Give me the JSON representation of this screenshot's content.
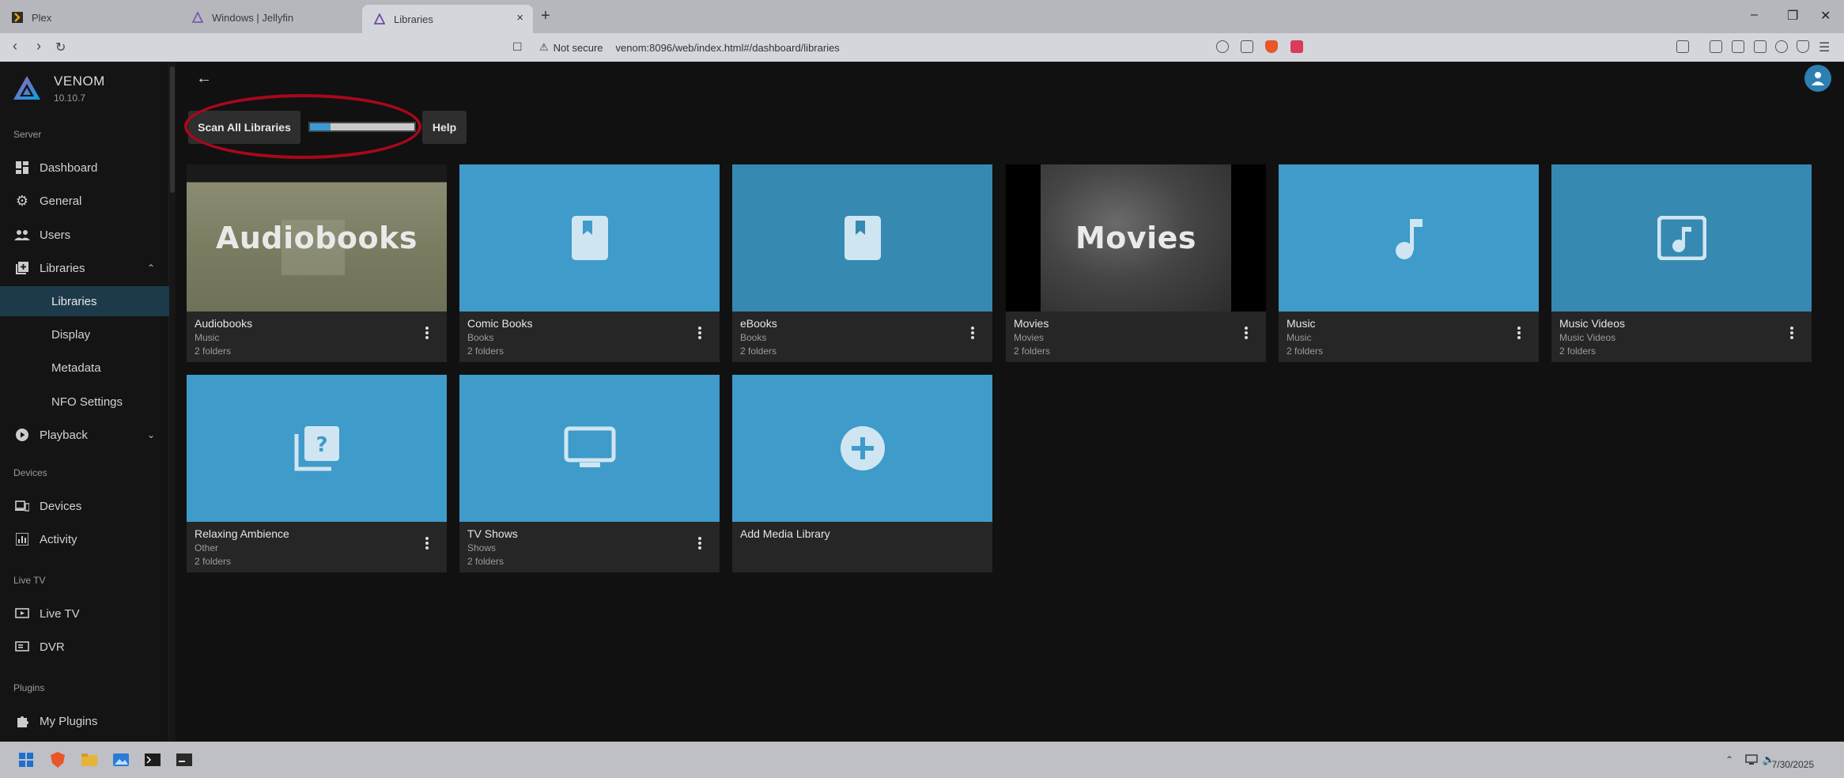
{
  "browser": {
    "tabs": [
      {
        "label": "Plex"
      },
      {
        "label": "Windows | Jellyfin"
      },
      {
        "label": "Libraries",
        "close": "×"
      }
    ],
    "new_tab": "+",
    "url_warning": "Not secure",
    "url": "venom:8096/web/index.html#/dashboard/libraries",
    "window_controls": [
      "–",
      "❐",
      "✕"
    ]
  },
  "server": {
    "name": "VENOM",
    "version": "10.10.7"
  },
  "sidebar": {
    "sections": {
      "server": "Server",
      "devices": "Devices",
      "livetv": "Live TV",
      "plugins": "Plugins"
    },
    "items": {
      "dashboard": "Dashboard",
      "general": "General",
      "users": "Users",
      "libraries": "Libraries",
      "libraries_sub": [
        "Libraries",
        "Display",
        "Metadata",
        "NFO Settings"
      ],
      "playback": "Playback",
      "devices": "Devices",
      "activity": "Activity",
      "livetv": "Live TV",
      "dvr": "DVR",
      "plugins": "My Plugins"
    }
  },
  "toolbar": {
    "scan_label": "Scan All Libraries",
    "help_label": "Help",
    "scan_progress": 0.2
  },
  "libraries": [
    {
      "name": "Audiobooks",
      "type": "Music",
      "folders": "2 folders",
      "overlay": "Audiobooks"
    },
    {
      "name": "Comic Books",
      "type": "Books",
      "folders": "2 folders",
      "icon": "book-icon"
    },
    {
      "name": "eBooks",
      "type": "Books",
      "folders": "2 folders",
      "icon": "book-icon"
    },
    {
      "name": "Movies",
      "type": "Movies",
      "folders": "2 folders",
      "overlay": "Movies"
    },
    {
      "name": "Music",
      "type": "Music",
      "folders": "2 folders",
      "icon": "music-note-icon"
    },
    {
      "name": "Music Videos",
      "type": "Music Videos",
      "folders": "2 folders",
      "icon": "music-video-icon"
    },
    {
      "name": "Relaxing Ambience",
      "type": "Other",
      "folders": "2 folders",
      "icon": "unknown-folder-icon"
    },
    {
      "name": "TV Shows",
      "type": "Shows",
      "folders": "2 folders",
      "icon": "tv-icon"
    },
    {
      "name": "Add Media Library",
      "icon": "add-circle-icon"
    }
  ],
  "taskbar": {
    "date": "7/30/2025"
  },
  "colors": {
    "accent": "#3f9bc9",
    "annotation": "#a8081a",
    "selected_nav": "#1d3a4a"
  }
}
